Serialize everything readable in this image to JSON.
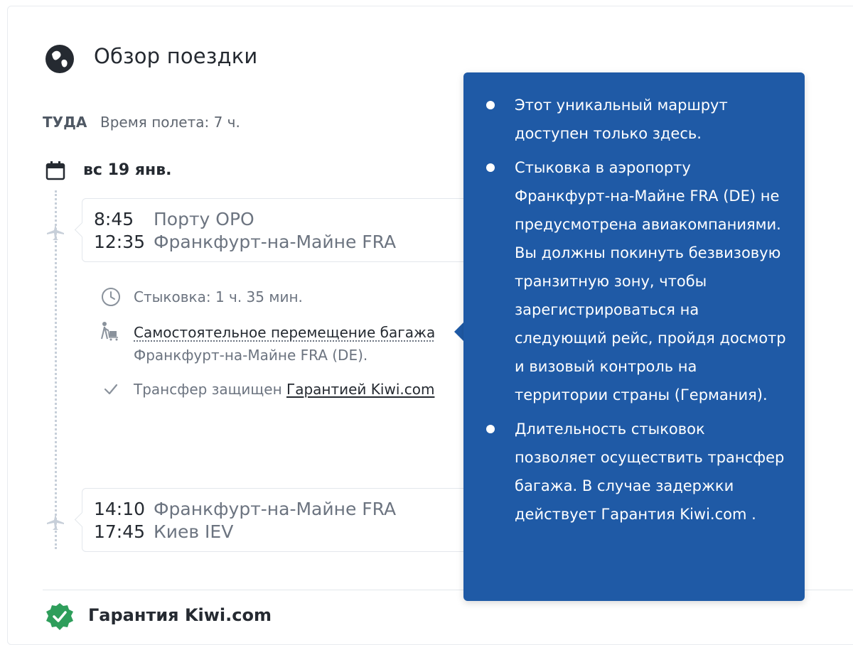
{
  "header": {
    "title": "Обзор поездки"
  },
  "outbound": {
    "direction": "ТУДА",
    "flight_time": "Время полета: 7 ч.",
    "date": "вс 19 янв."
  },
  "segments": [
    {
      "dep_time": "8:45",
      "dep_place": "Порту OPO",
      "arr_time": "12:35",
      "arr_place": "Франкфурт-на-Майне FRA"
    },
    {
      "dep_time": "14:10",
      "dep_place": "Франкфурт-на-Майне FRA",
      "arr_time": "17:45",
      "arr_place": "Киев IEV"
    }
  ],
  "layover": {
    "duration": "Стыковка: 1 ч. 35 мин.",
    "baggage_link": "Самостоятельное перемещение багажа",
    "baggage_place": "Франкфурт-на-Майне FRA (DE).",
    "transfer_text": "Трансфер защищен ",
    "transfer_link": "Гарантией Kiwi.com"
  },
  "guarantee": {
    "title": "Гарантия Kiwi.com"
  },
  "tooltip": {
    "items": [
      "Этот уникальный маршрут доступен только здесь.",
      "Стыковка в аэропорту Франкфурт-на-Майне FRA (DE) не предусмотрена авиакомпаниями. Вы должны покинуть безвизовую транзитную зону, чтобы зарегистрироваться на следующий рейс, пройдя досмотр и визовый контроль на территории страны (Германия).",
      "Длительность стыковок позволяет осуществить трансфер багажа. В случае задержки действует Гарантия Kiwi.com ."
    ]
  },
  "colors": {
    "tooltip_bg": "#1f5aa6",
    "guarantee_green": "#2e9e5b",
    "text_dark": "#252a31",
    "text_muted": "#6c7480"
  },
  "icons": [
    "globe-icon",
    "calendar-icon",
    "plane-icon",
    "clock-icon",
    "baggage-trolley-icon",
    "check-icon",
    "guarantee-badge-icon"
  ]
}
